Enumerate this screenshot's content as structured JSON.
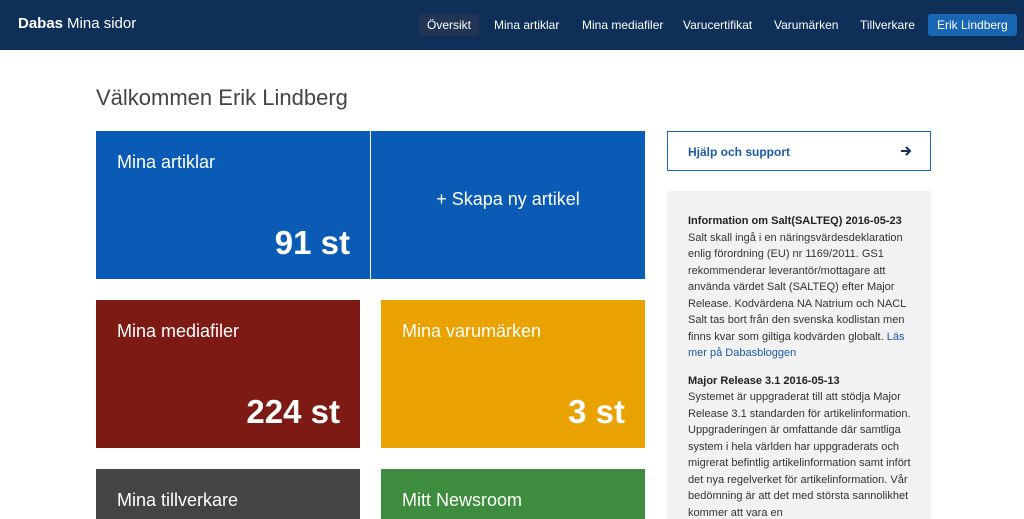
{
  "brand": {
    "name": "Dabas",
    "sub": "Mina sidor"
  },
  "nav": {
    "items": [
      {
        "label": "Översikt"
      },
      {
        "label": "Mina artiklar"
      },
      {
        "label": "Mina mediafiler"
      },
      {
        "label": "Varucertifikat"
      },
      {
        "label": "Varumärken"
      },
      {
        "label": "Tillverkare"
      }
    ],
    "user": "Erik Lindberg"
  },
  "welcome": "Välkommen Erik Lindberg",
  "tiles": {
    "articles": {
      "title": "Mina artiklar",
      "count": "91 st",
      "color": "#0a5bb5"
    },
    "new_article": {
      "label": "+ Skapa ny artikel",
      "color": "#0a5bb5"
    },
    "media": {
      "title": "Mina mediafiler",
      "count": "224 st",
      "color": "#7d1a13"
    },
    "brands": {
      "title": "Mina varumärken",
      "count": "3 st",
      "color": "#e9a200"
    },
    "manufacturers": {
      "title": "Mina tillverkare",
      "color": "#444444"
    },
    "newsroom": {
      "title": "Mitt Newsroom",
      "color": "#3e8c3d"
    }
  },
  "help": {
    "label": "Hjälp och support",
    "icon": "arrow-right-icon"
  },
  "news": [
    {
      "title": "Information om Salt(SALTEQ) 2016-05-23",
      "body": "Salt skall ingå i en näringsvärdesdeklaration enlig förordning (EU) nr 1169/2011. GS1 rekommenderar leverantör/mottagare att använda värdet Salt (SALTEQ) efter Major Release. Kodvärdena NA Natrium och NACL Salt tas bort från den svenska kodlistan men finns kvar som giltiga kodvärden globalt.",
      "link": "Läs mer på Dabasbloggen"
    },
    {
      "title": "Major Release 3.1 2016-05-13",
      "body": "Systemet är uppgraderat till att stödja Major Release 3.1 standarden för artikelinformation. Uppgraderingen är omfattande där samtliga system i hela världen har uppgraderats och migrerat befintlig artikelinformation samt infört det nya regelverket för artikelinformation. Vår bedömning är att det med största sannolikhet kommer att vara en"
    }
  ]
}
